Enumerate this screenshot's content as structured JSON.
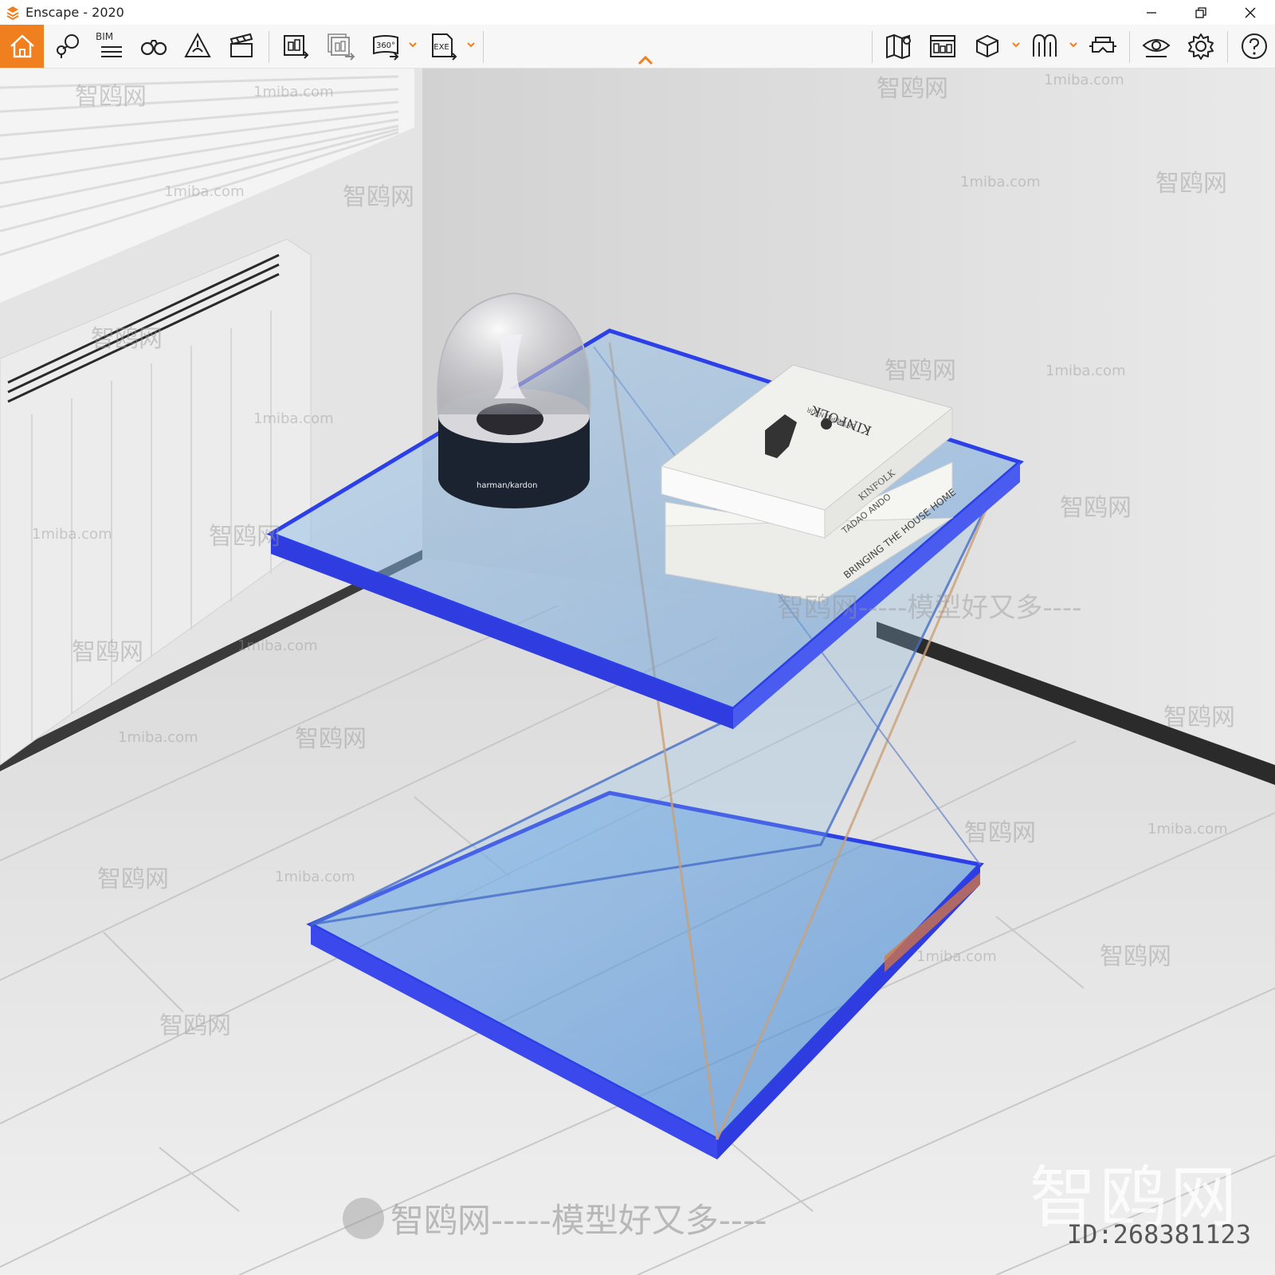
{
  "window": {
    "title": "Enscape - 2020",
    "accent_color": "#f07f1f"
  },
  "toolbar": {
    "bim_label": "BIM",
    "left_icons": [
      "home-icon",
      "map-pin-icon",
      "bim-list-icon",
      "binoculars-icon",
      "sun-cone-icon",
      "clapperboard-icon"
    ],
    "export_icons": [
      "export-image-icon",
      "export-batch-icon",
      "export-360-icon",
      "export-exe-icon"
    ],
    "badge_360": "360°",
    "badge_exe": "EXE",
    "right_icons": [
      "map-icon",
      "asset-library-icon",
      "cube-icon",
      "material-icon",
      "vr-headset-icon",
      "eye-icon",
      "gear-icon",
      "help-icon"
    ]
  },
  "scene": {
    "book_title": "KINFOLK",
    "book_subtitle": "ENTREPRENEUR",
    "book_spine_1": "KINFOLK",
    "book_spine_2": "TADAO ANDO",
    "book_spine_3": "BRINGING THE HOUSE HOME",
    "speaker_brand": "harman/kardon"
  },
  "watermarks": {
    "brand_cn": "智鸥网",
    "site": "1miba.com",
    "slogan": "智鸥网-----模型好又多----",
    "id_text": "ID:268381123"
  }
}
